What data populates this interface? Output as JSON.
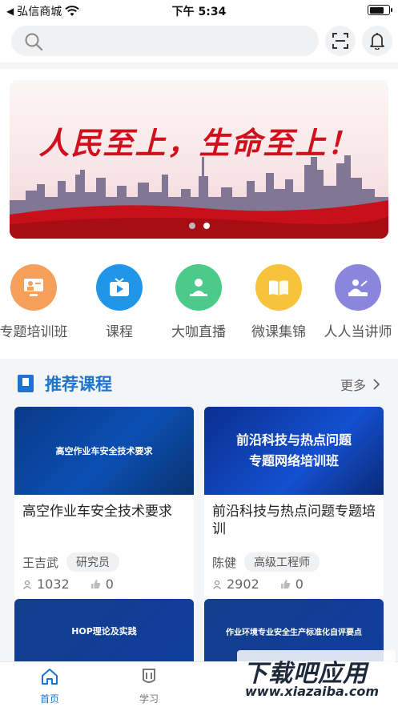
{
  "status_bar": {
    "carrier": "弘信商城",
    "time": "下午 5:34",
    "battery_level": 0.8
  },
  "search": {
    "placeholder": ""
  },
  "banner": {
    "slogan": "人民至上，生命至上！",
    "page_count": 2,
    "active_page": 2
  },
  "quick_menu": [
    {
      "label": "专题培训班",
      "icon": "training-class-icon",
      "color": "#f5a05a"
    },
    {
      "label": "课程",
      "icon": "tv-play-icon",
      "color": "#2196e8"
    },
    {
      "label": "大咖直播",
      "icon": "live-speaker-icon",
      "color": "#4cca8a"
    },
    {
      "label": "微课集锦",
      "icon": "open-book-icon",
      "color": "#f7c33a"
    },
    {
      "label": "人人当讲师",
      "icon": "lecturer-icon",
      "color": "#8a86de"
    }
  ],
  "recommended": {
    "title": "推荐课程",
    "more_label": "更多",
    "courses": [
      {
        "thumb_text": "高空作业车安全技术要求",
        "title": "高空作业车安全技术要求",
        "author": "王吉武",
        "badge": "研究员",
        "views": "1032",
        "likes": "0"
      },
      {
        "thumb_text": "前沿科技与热点问题\n专题网络培训班",
        "title": "前沿科技与热点问题专题培训",
        "author": "陈健",
        "badge": "高级工程师",
        "views": "2902",
        "likes": "0"
      }
    ],
    "more_courses": [
      {
        "thumb_text": "HOP理论及实践"
      },
      {
        "thumb_text": "作业环境专业安全生产标准化自评要点"
      }
    ]
  },
  "tabbar": [
    {
      "label": "首页",
      "icon": "home-icon",
      "active": true
    },
    {
      "label": "学习",
      "icon": "study-icon",
      "active": false
    }
  ],
  "watermark": {
    "main": "下载吧应用",
    "sub": "www.xiazaiba.com"
  },
  "colors": {
    "accent": "#1b75d0",
    "banner_red": "#d0101c"
  }
}
